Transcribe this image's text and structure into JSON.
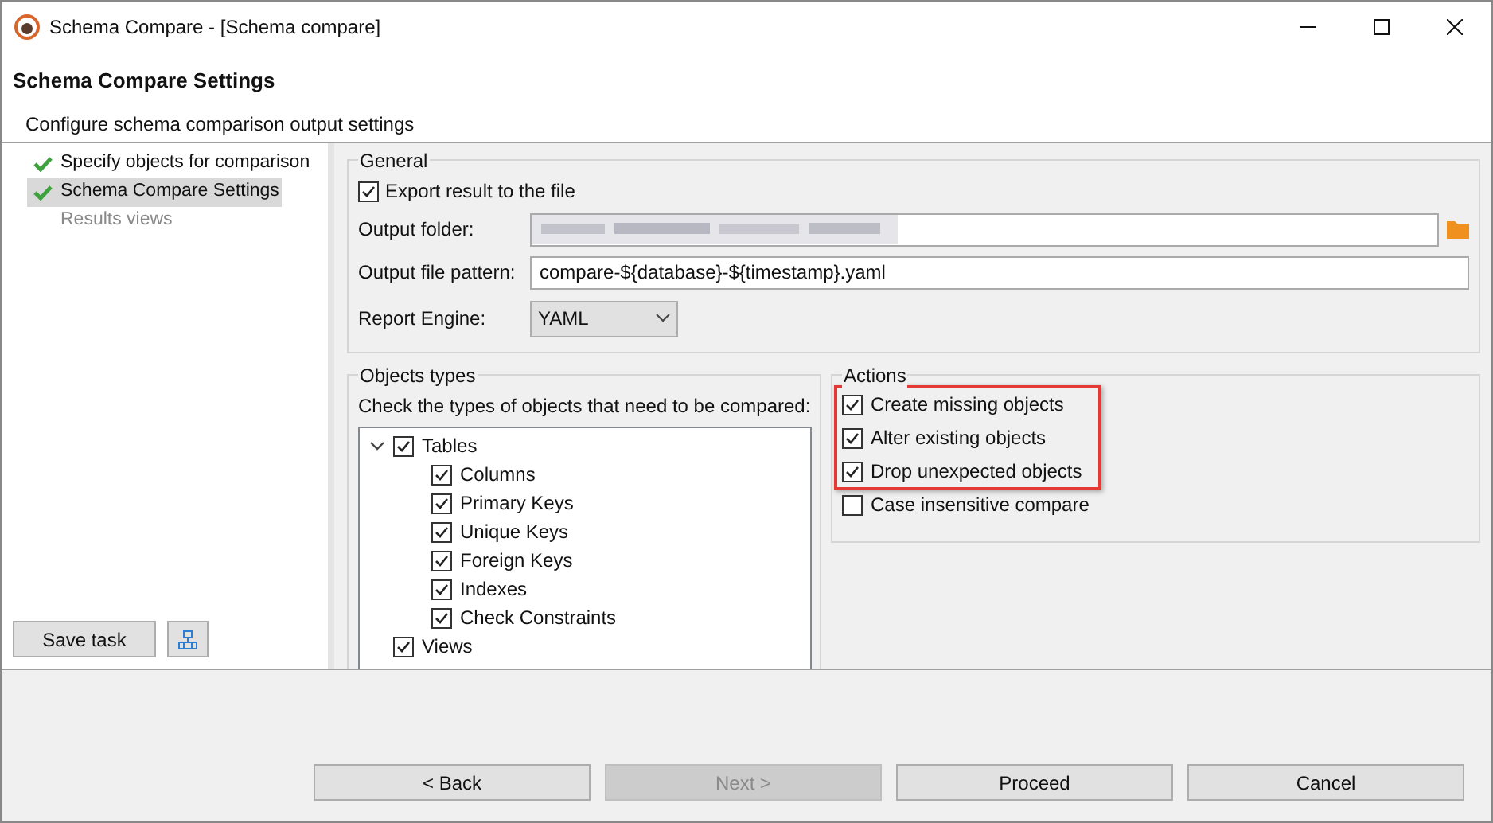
{
  "window": {
    "title": "Schema Compare - [Schema compare]"
  },
  "header": {
    "title": "Schema Compare Settings",
    "subtitle": "Configure schema comparison output settings"
  },
  "steps": [
    {
      "label": "Specify objects for comparison",
      "completed": true,
      "selected": false
    },
    {
      "label": "Schema Compare Settings",
      "completed": true,
      "selected": true
    },
    {
      "label": "Results views",
      "completed": false,
      "selected": false
    }
  ],
  "save_task": {
    "label": "Save task"
  },
  "general": {
    "title": "General",
    "export": {
      "label": "Export result to the file",
      "checked": true
    },
    "output_folder": {
      "label": "Output folder:"
    },
    "file_pattern": {
      "label": "Output file pattern:",
      "value": "compare-${database}-${timestamp}.yaml"
    },
    "report_engine": {
      "label": "Report Engine:",
      "value": "YAML"
    }
  },
  "objects_types": {
    "title": "Objects types",
    "hint": "Check the types of objects that need to be compared:",
    "items": [
      {
        "label": "Tables",
        "checked": true,
        "expanded": true,
        "children": [
          {
            "label": "Columns",
            "checked": true
          },
          {
            "label": "Primary Keys",
            "checked": true
          },
          {
            "label": "Unique Keys",
            "checked": true
          },
          {
            "label": "Foreign Keys",
            "checked": true
          },
          {
            "label": "Indexes",
            "checked": true
          },
          {
            "label": "Check Constraints",
            "checked": true
          }
        ]
      },
      {
        "label": "Views",
        "checked": true
      }
    ]
  },
  "actions": {
    "title": "Actions",
    "items": [
      {
        "label": "Create missing objects",
        "checked": true,
        "highlighted": true
      },
      {
        "label": "Alter existing objects",
        "checked": true,
        "highlighted": true
      },
      {
        "label": "Drop unexpected objects",
        "checked": true,
        "highlighted": true
      },
      {
        "label": "Case insensitive compare",
        "checked": false,
        "highlighted": false
      }
    ]
  },
  "buttons": [
    {
      "label": "< Back",
      "disabled": false
    },
    {
      "label": "Next >",
      "disabled": true
    },
    {
      "label": "Proceed",
      "disabled": false
    },
    {
      "label": "Cancel",
      "disabled": false
    }
  ]
}
